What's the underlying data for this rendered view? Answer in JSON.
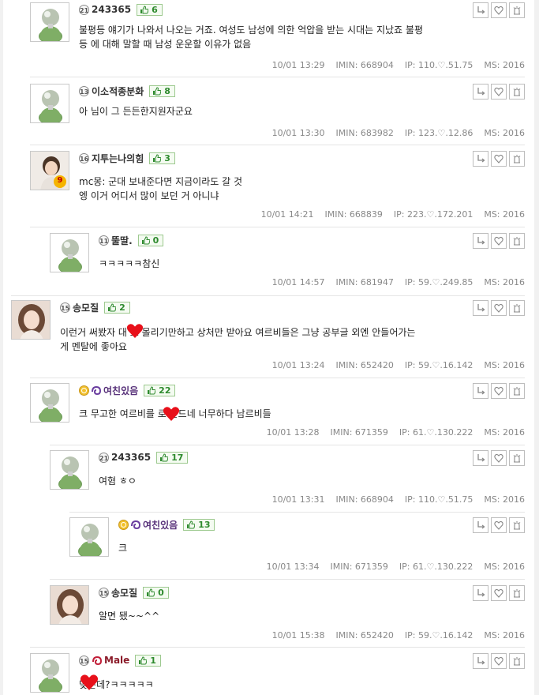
{
  "colors": {
    "heart": "#e8101a",
    "like_green": "#2d8a2d",
    "meta_gray": "#888888"
  },
  "comments": [
    {
      "level": "21",
      "nick": "243365",
      "likes": "6",
      "text": [
        "불평등 얘기가 나와서 나오는 거죠. 여성도 남성에 의한 억압을 받는 시대는 지났죠 불평",
        "등 에 대해 말할 때 남성 운운할 이유가 없음"
      ],
      "date": "10/01 13:29",
      "imin": "IMIN: 668904",
      "ip": "IP: 110.♡.51.75",
      "ms": "MS: 2016"
    },
    {
      "level": "13",
      "nick": "이소적종분화",
      "likes": "8",
      "text": [
        "아 님이 그 든든한지원자군요"
      ],
      "date": "10/01 13:30",
      "imin": "IMIN: 683982",
      "ip": "IP: 123.♡.12.86",
      "ms": "MS: 2016"
    },
    {
      "level": "16",
      "nick": "지투는나의힘",
      "likes": "3",
      "text": [
        "mc몽: 군대 보내준다면 지금이라도 갈 것",
        "엥 이거 어디서 많이 보던 거 아니냐"
      ],
      "date": "10/01 14:21",
      "imin": "IMIN: 668839",
      "ip": "IP: 223.♡.172.201",
      "ms": "MS: 2016",
      "avatar_badge": "9"
    },
    {
      "level": "11",
      "nick": "뚤딸.",
      "likes": "0",
      "text": [
        "ㅋㅋㅋㅋㅋ참신"
      ],
      "date": "10/01 14:57",
      "imin": "IMIN: 681947",
      "ip": "IP: 59.♡.249.85",
      "ms": "MS: 2016"
    },
    {
      "level": "15",
      "nick": "송모질",
      "likes": "2",
      "text": [
        "이런거 써봤자 대    로 몰리기만하고 상처만 받아요 여르비들은 그냥 공부글 외엔 안들어가는",
        "게 멘탈에 좋아요"
      ],
      "date": "10/01 13:24",
      "imin": "IMIN: 652420",
      "ip": "IP: 59.♡.16.142",
      "ms": "MS: 2016"
    },
    {
      "level": "",
      "nick": "여친있음",
      "likes": "22",
      "text": [
        "크 무고한 여르비를       로 만드네 너무하다 남르비들"
      ],
      "date": "10/01 13:28",
      "imin": "IMIN: 671359",
      "ip": "IP: 61.♡.130.222",
      "ms": "MS: 2016"
    },
    {
      "level": "21",
      "nick": "243365",
      "likes": "17",
      "text": [
        "여혐 ㅎㅇ"
      ],
      "date": "10/01 13:31",
      "imin": "IMIN: 668904",
      "ip": "IP: 110.♡.51.75",
      "ms": "MS: 2016"
    },
    {
      "level": "",
      "nick": "여친있음",
      "likes": "13",
      "text": [
        "크"
      ],
      "date": "10/01 13:34",
      "imin": "IMIN: 671359",
      "ip": "IP: 61.♡.130.222",
      "ms": "MS: 2016"
    },
    {
      "level": "15",
      "nick": "송모질",
      "likes": "0",
      "text": [
        "알면 됐~~^^"
      ],
      "date": "10/01 15:38",
      "imin": "IMIN: 652420",
      "ip": "IP: 59.♡.16.142",
      "ms": "MS: 2016"
    },
    {
      "level": "15",
      "nick": "Male",
      "likes": "1",
      "text": [
        "      맞는데?ㅋㅋㅋㅋㅋ"
      ],
      "date": "",
      "imin": "",
      "ip": "",
      "ms": ""
    }
  ]
}
